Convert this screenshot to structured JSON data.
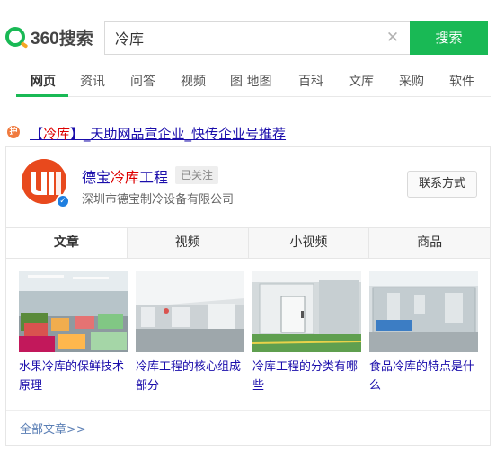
{
  "header": {
    "logo_text": "360搜索",
    "search_value": "冷库",
    "clear_icon": "close-icon",
    "search_button": "搜索"
  },
  "nav": {
    "items": [
      "网页",
      "资讯",
      "问答",
      "视频",
      "图 地图",
      "百科",
      "文库",
      "采购",
      "软件"
    ],
    "active_index": 0
  },
  "result": {
    "badge_text": "护",
    "title_prefix": "【",
    "title_highlight": "冷库",
    "title_suffix": "】_天助网品宣企业_快传企业号推荐",
    "company": {
      "name_prefix": "德宝",
      "name_highlight": "冷库",
      "name_suffix": "工程",
      "follow_badge": "已关注",
      "subtitle": "深圳市德宝制冷设备有限公司",
      "contact_button": "联系方式"
    },
    "tabs": [
      "文章",
      "视频",
      "小视频",
      "商品"
    ],
    "active_tab": 0,
    "articles": [
      {
        "title": "水果冷库的保鲜技术原理"
      },
      {
        "title": "冷库工程的核心组成部分"
      },
      {
        "title": "冷库工程的分类有哪些"
      },
      {
        "title": "食品冷库的特点是什么"
      }
    ],
    "all_articles_link": "全部文章>>"
  },
  "colors": {
    "brand_green": "#19b955",
    "link_blue": "#1a0dab",
    "highlight_red": "#dd0000",
    "logo_orange": "#e8491d",
    "verify_blue": "#1e7fe0"
  }
}
